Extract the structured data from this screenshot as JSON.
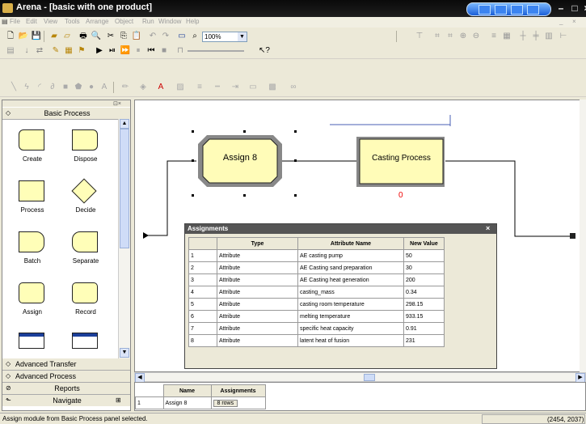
{
  "app": {
    "title": "Arena - [basic with one product]"
  },
  "menu": [
    "File",
    "Edit",
    "View",
    "Tools",
    "Arrange",
    "Object",
    "Run",
    "Window",
    "Help"
  ],
  "toolbar": {
    "zoom_value": "100%"
  },
  "panels": {
    "basic_process": {
      "title": "Basic Process",
      "modules": [
        "Create",
        "Dispose",
        "Process",
        "Decide",
        "Batch",
        "Separate",
        "Assign",
        "Record"
      ]
    },
    "advanced_transfer": "Advanced Transfer",
    "advanced_process": "Advanced Process",
    "reports": "Reports",
    "navigate": "Navigate"
  },
  "canvas": {
    "assign_block": "Assign 8",
    "process_block": "Casting Process",
    "process_counter": "0"
  },
  "assignments": {
    "title": "Assignments",
    "columns": [
      "",
      "Type",
      "Attribute Name",
      "New Value"
    ],
    "rows": [
      [
        "1",
        "Attribute",
        "AE casting pump",
        "50"
      ],
      [
        "2",
        "Attribute",
        "AE Casting sand preparation",
        "30"
      ],
      [
        "3",
        "Attribute",
        "AE Casting heat generation",
        "200"
      ],
      [
        "4",
        "Attribute",
        "casting_mass",
        "0.34"
      ],
      [
        "5",
        "Attribute",
        "casting room temperature",
        "298.15"
      ],
      [
        "6",
        "Attribute",
        "melting temperature",
        "933.15"
      ],
      [
        "7",
        "Attribute",
        "specific heat capacity",
        "0.91"
      ],
      [
        "8",
        "Attribute",
        "latent heat of fusion",
        "231"
      ]
    ]
  },
  "sheet": {
    "columns": [
      "",
      "Name",
      "Assignments"
    ],
    "row": [
      "1",
      "Assign 8",
      "8 rows"
    ]
  },
  "status": {
    "message": "Assign module from Basic Process panel selected.",
    "coords": "(2454, 2037)"
  }
}
